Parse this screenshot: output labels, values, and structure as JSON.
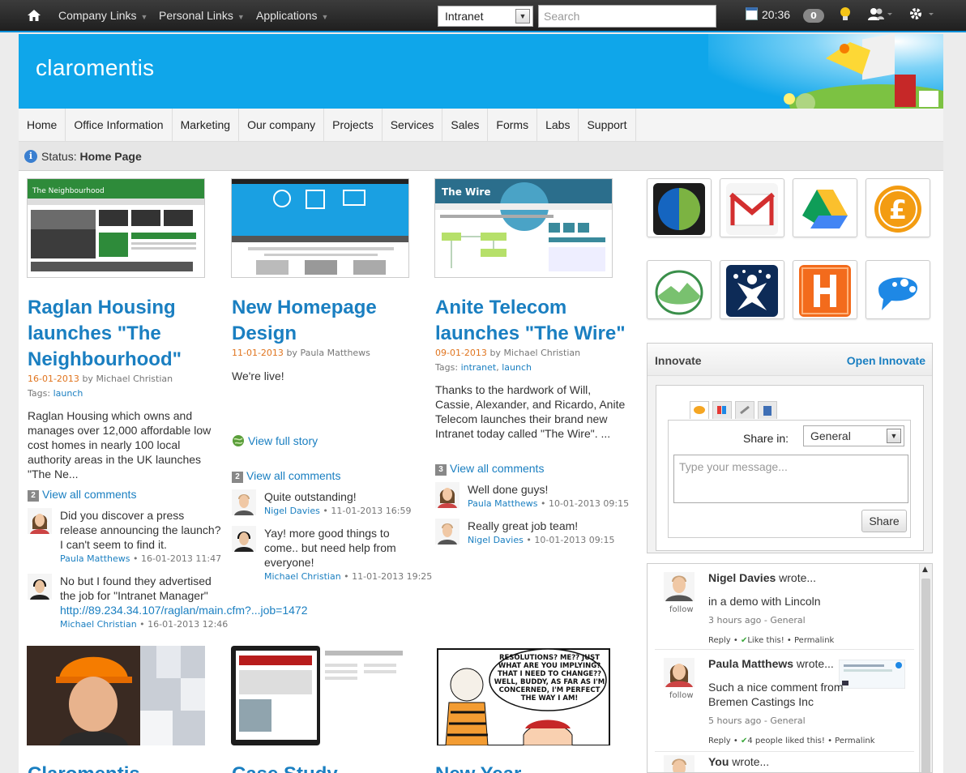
{
  "topbar": {
    "menus": [
      "Company Links",
      "Personal Links",
      "Applications"
    ],
    "site_select": "Intranet",
    "search_placeholder": "Search",
    "time": "20:36",
    "notifications": "0"
  },
  "banner": {
    "logo": "claromentis"
  },
  "nav": {
    "items": [
      "Home",
      "Office Information",
      "Marketing",
      "Our company",
      "Projects",
      "Services",
      "Sales",
      "Forms",
      "Labs",
      "Support"
    ]
  },
  "status": {
    "label": "Status:",
    "value": "Home Page"
  },
  "articles": [
    {
      "title": "Raglan Housing launches \"The Neighbourhood\"",
      "date": "16-01-2013",
      "by": "by",
      "author": "Michael Christian",
      "tags_label": "Tags:",
      "tags": "launch",
      "body": "Raglan Housing which owns and manages over 12,000 affordable low cost homes in nearly 100 local authority areas in the UK launches \"The Ne...",
      "comments_count": "2",
      "view_comments": "View all comments",
      "comments": [
        {
          "text": "Did you discover a press release announcing the launch? I can't seem to find it.",
          "author": "Paula Matthews",
          "when": "16-01-2013 11:47"
        },
        {
          "text": "No but I found they advertised the job for \"Intranet Manager\"",
          "link": "http://89.234.34.107/raglan/main.cfm?...job=1472",
          "author": "Michael Christian",
          "when": "16-01-2013 12:46"
        }
      ],
      "shot_title": "The Neighbourhood"
    },
    {
      "title": "New Homepage Design",
      "date": "11-01-2013",
      "by": "by",
      "author": "Paula Matthews",
      "body": "We're live!",
      "view_full": "View full story",
      "comments_count": "2",
      "view_comments": "View all comments",
      "comments": [
        {
          "text": "Quite outstanding!",
          "author": "Nigel Davies",
          "when": "11-01-2013 16:59"
        },
        {
          "text": "Yay! more good things to come.. but need help from everyone!",
          "author": "Michael Christian",
          "when": "11-01-2013 19:25"
        }
      ]
    },
    {
      "title": "Anite Telecom launches \"The Wire\"",
      "date": "09-01-2013",
      "by": "by",
      "author": "Michael Christian",
      "tags_label": "Tags:",
      "tag1": "intranet",
      "tag2": "launch",
      "body": "Thanks to the hardwork of Will, Cassie, Alexander, and Ricardo, Anite Telecom launches their brand new Intranet today called \"The Wire\".  ...",
      "comments_count": "3",
      "view_comments": "View all comments",
      "comments": [
        {
          "text": "Well done guys!",
          "author": "Paula Matthews",
          "when": "10-01-2013 09:15"
        },
        {
          "text": "Really great job team!",
          "author": "Nigel Davies",
          "when": "10-01-2013 09:15"
        }
      ],
      "shot_title": "The Wire"
    }
  ],
  "bottom_articles": [
    "Claromentis",
    "Case Study",
    "New Year"
  ],
  "comic_text": "RESOLUTIONS? ME?? JUST WHAT ARE YOU IMPLYING? THAT I NEED TO CHANGE?? WELL, BUDDY, AS FAR AS I'M CONCERNED, I'M PERFECT THE WAY I AM!",
  "apps": [
    "globe-app-icon",
    "gmail-icon",
    "google-drive-icon",
    "pound-finance-icon",
    "basecamp-icon",
    "people-network-icon",
    "harvest-h-icon",
    "chat-bubble-icon"
  ],
  "innovate": {
    "title": "Innovate",
    "open_link": "Open Innovate",
    "share_in_label": "Share in:",
    "share_in_value": "General",
    "message_placeholder": "Type your message...",
    "share_button": "Share"
  },
  "feed": [
    {
      "name": "Nigel Davies",
      "wrote": "wrote...",
      "msg": "in a demo with Lincoln",
      "ago": "3 hours ago - General",
      "reply": "Reply",
      "like": "Like this!",
      "perma": "Permalink",
      "follow": "follow"
    },
    {
      "name": "Paula Matthews",
      "wrote": "wrote...",
      "msg": "Such a nice comment from Bremen Castings Inc",
      "ago": "5 hours ago - General",
      "reply": "Reply",
      "like": "4 people liked this!",
      "perma": "Permalink",
      "follow": "follow"
    },
    {
      "name": "You",
      "wrote": "wrote..."
    }
  ],
  "colors": {
    "accent": "#0fa6ea",
    "link": "#1a7fc1",
    "date": "#e0741e",
    "topbar": "#2a2a2a"
  }
}
